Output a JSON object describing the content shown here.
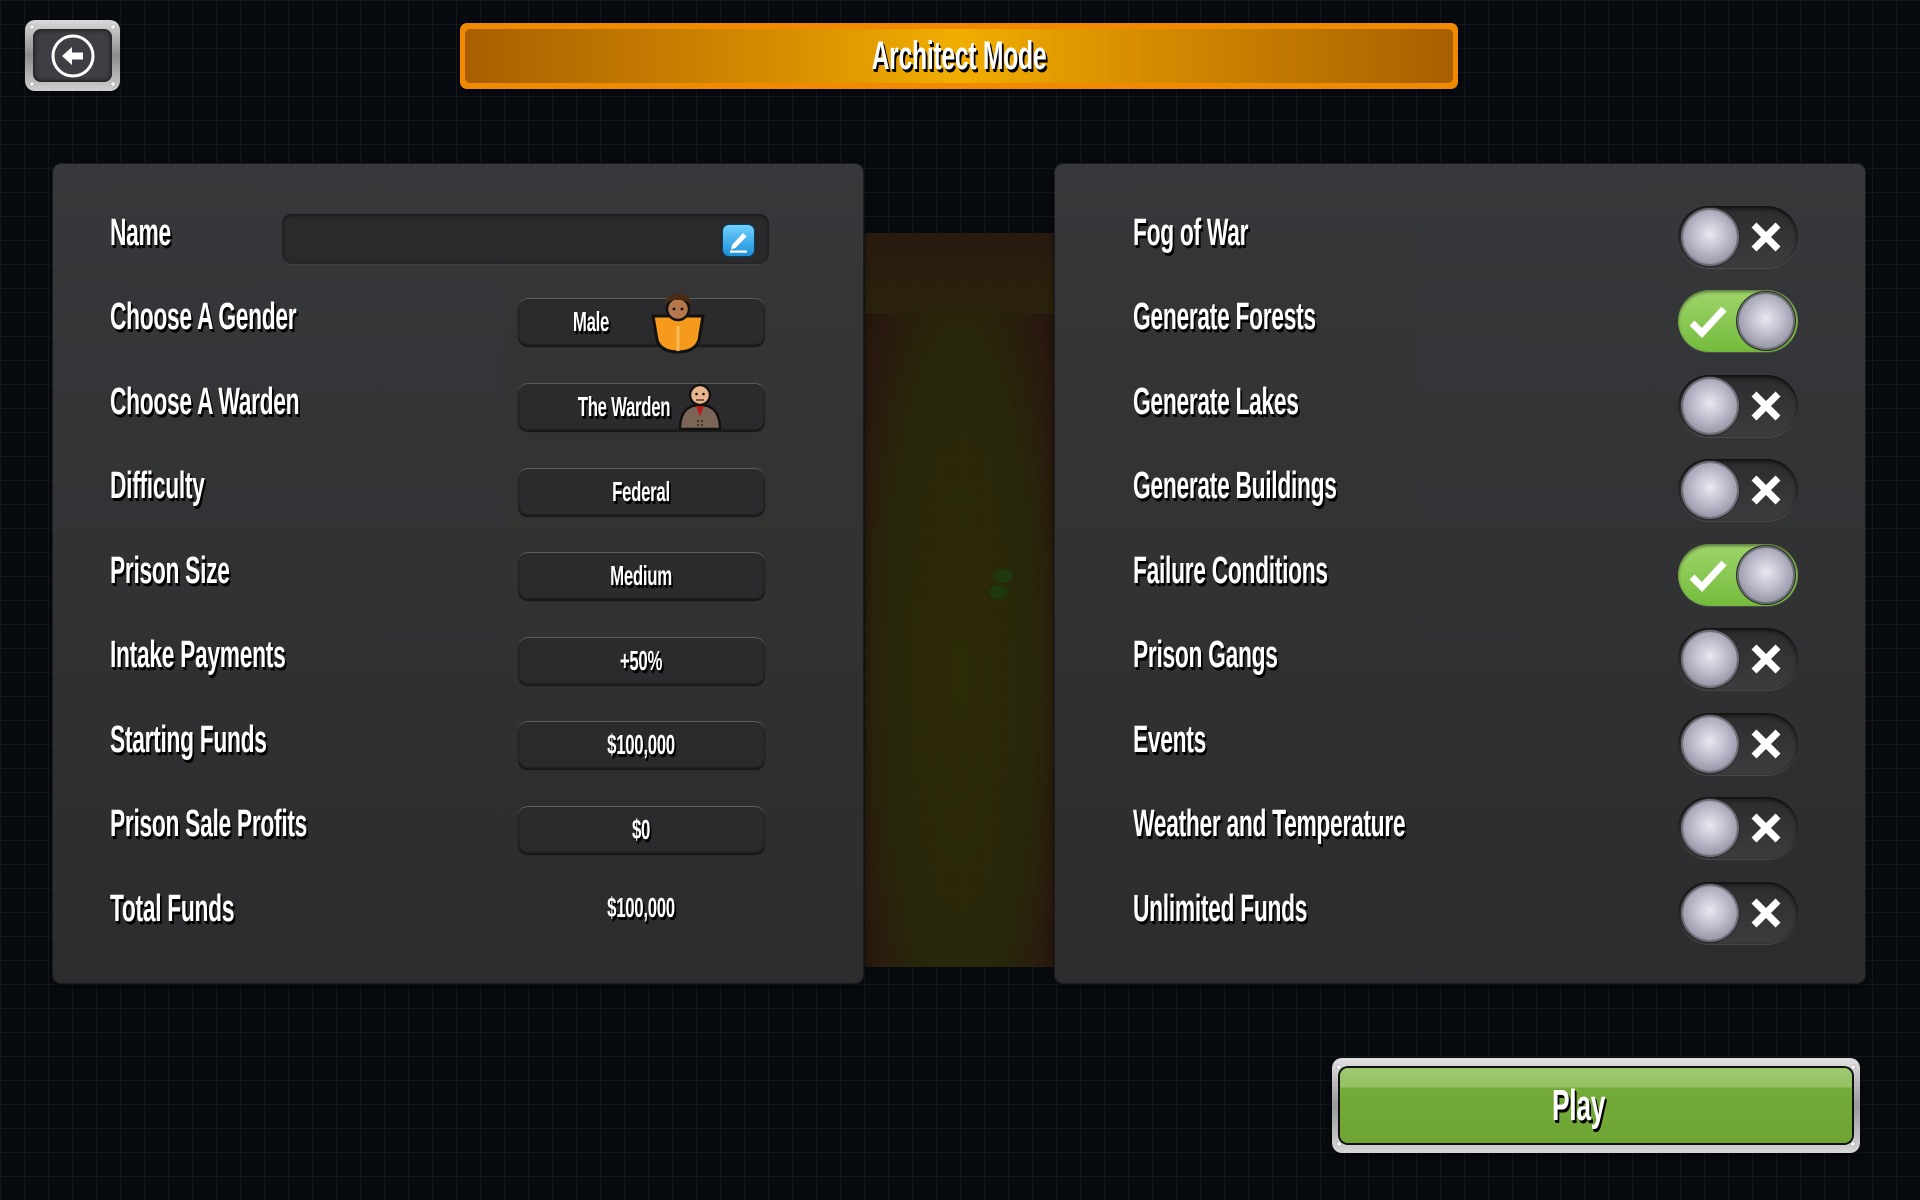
{
  "header": {
    "title": "Architect Mode",
    "back_icon": "back-arrow-circle-icon"
  },
  "settings": {
    "name": {
      "label": "Name",
      "value": "",
      "placeholder": "",
      "edit_icon": "pencil-edit-icon"
    },
    "gender": {
      "label": "Choose A Gender",
      "value": "Male",
      "avatar_icon": "male-prisoner-avatar-icon"
    },
    "warden": {
      "label": "Choose A Warden",
      "value": "The Warden",
      "avatar_icon": "warden-avatar-icon"
    },
    "difficulty": {
      "label": "Difficulty",
      "value": "Federal"
    },
    "prison_size": {
      "label": "Prison Size",
      "value": "Medium"
    },
    "intake_payments": {
      "label": "Intake Payments",
      "value": "+50%"
    },
    "starting_funds": {
      "label": "Starting Funds",
      "value": "$100,000"
    },
    "prison_sale_profits": {
      "label": "Prison Sale Profits",
      "value": "$0"
    },
    "total_funds": {
      "label": "Total Funds",
      "value": "$100,000"
    }
  },
  "toggles": [
    {
      "label": "Fog of War",
      "enabled": false
    },
    {
      "label": "Generate Forests",
      "enabled": true
    },
    {
      "label": "Generate Lakes",
      "enabled": false
    },
    {
      "label": "Generate Buildings",
      "enabled": false
    },
    {
      "label": "Failure Conditions",
      "enabled": true
    },
    {
      "label": "Prison Gangs",
      "enabled": false
    },
    {
      "label": "Events",
      "enabled": false
    },
    {
      "label": "Weather and Temperature",
      "enabled": false
    },
    {
      "label": "Unlimited Funds",
      "enabled": false
    }
  ],
  "footer": {
    "play_label": "Play"
  },
  "colors": {
    "title_orange": "#f08a00",
    "toggle_on_green": "#7cc043",
    "play_green": "#6fa534",
    "edit_blue": "#1e90d8"
  }
}
